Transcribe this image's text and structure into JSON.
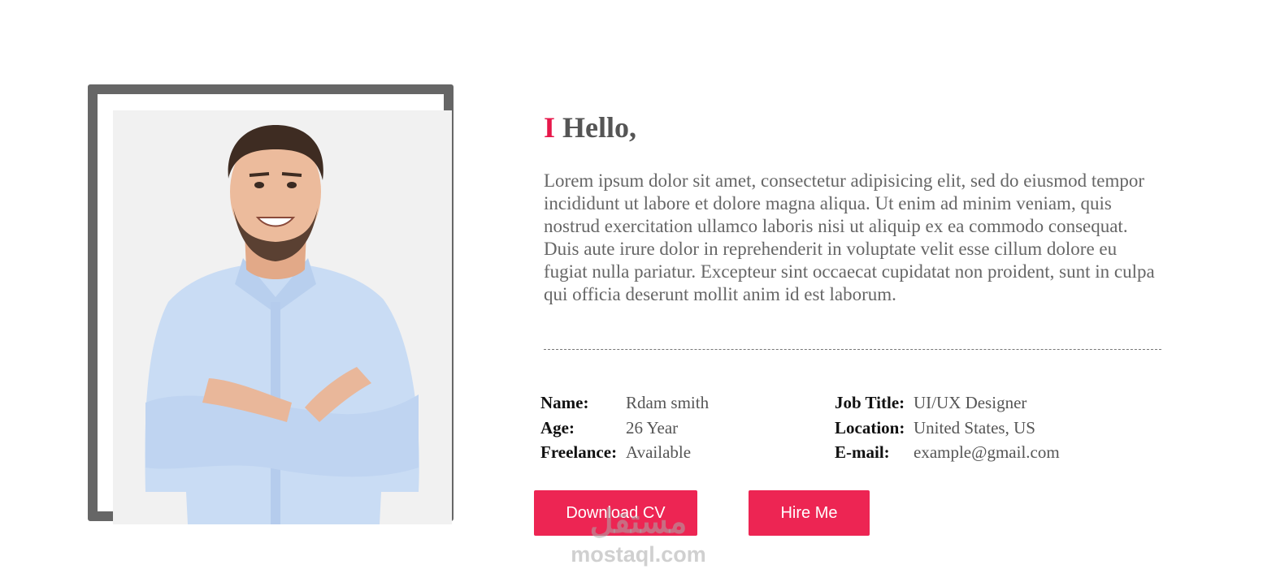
{
  "greeting": {
    "accent": "I",
    "text": "Hello,"
  },
  "intro": "Lorem ipsum dolor sit amet, consectetur adipisicing elit, sed do eiusmod tempor incididunt ut labore et dolore magna aliqua. Ut enim ad minim veniam, quis nostrud exercitation ullamco laboris nisi ut aliquip ex ea commodo consequat. Duis aute irure dolor in reprehenderit in voluptate velit esse cillum dolore eu fugiat nulla pariatur. Excepteur sint occaecat cupidatat non proident, sunt in culpa qui officia deserunt mollit anim id est laborum.",
  "info_left": [
    {
      "label": "Name:",
      "value": "Rdam smith"
    },
    {
      "label": "Age:",
      "value": "26 Year"
    },
    {
      "label": "Freelance:",
      "value": "Available"
    }
  ],
  "info_right": [
    {
      "label": "Job Title:",
      "value": "UI/UX Designer"
    },
    {
      "label": "Location:",
      "value": "United States, US"
    },
    {
      "label": "E-mail:",
      "value": "example@gmail.com"
    }
  ],
  "buttons": {
    "download": "Download CV",
    "hire": "Hire Me"
  },
  "watermark": {
    "arabic": "مستقل",
    "latin": "mostaql.com"
  },
  "colors": {
    "accent": "#e7174a",
    "button": "#ed2553",
    "frame": "#666666"
  }
}
